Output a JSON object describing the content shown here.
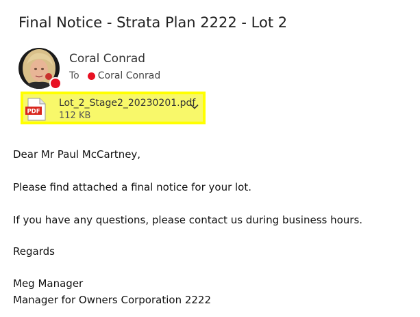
{
  "email": {
    "subject": "Final Notice - Strata Plan 2222 - Lot 2",
    "sender": {
      "name": "Coral Conrad",
      "avatar_icon": "person-photo-avatar",
      "presence_color": "#e81123"
    },
    "recipient": {
      "label": "To",
      "name": "Coral Conrad",
      "presence_color": "#e81123"
    },
    "attachment": {
      "icon": "pdf-file-icon",
      "icon_text": "PDF",
      "file_name": "Lot_2_Stage2_20230201.pdf",
      "file_size": "112 KB",
      "highlight_color": "#ffff00"
    },
    "body": {
      "greeting": "Dear Mr Paul McCartney,",
      "paragraph1": "Please find attached a final notice for your lot.",
      "paragraph2": "If you have any questions, please contact us during business hours.",
      "closing": "Regards",
      "signature_name": "Meg Manager",
      "signature_title": "Manager for Owners Corporation 2222"
    }
  }
}
